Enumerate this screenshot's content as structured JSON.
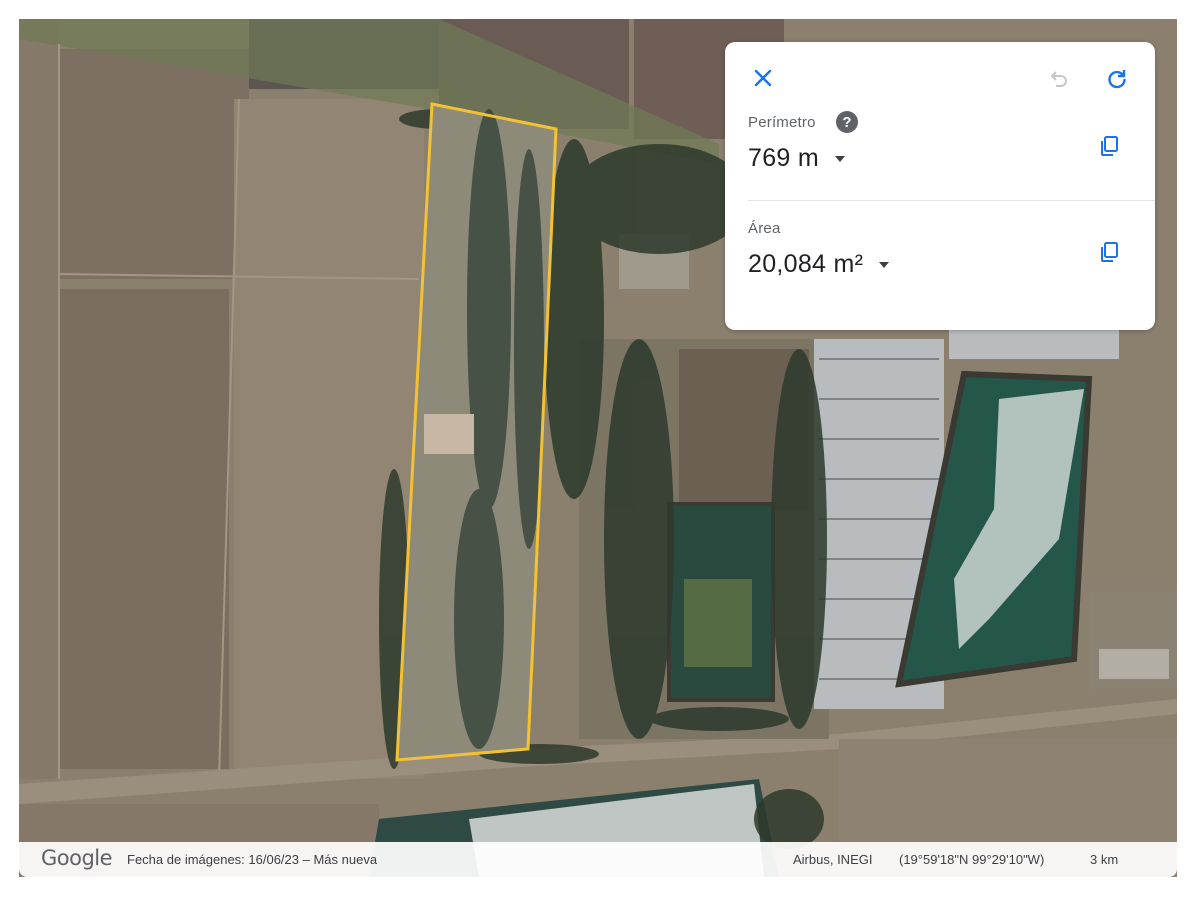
{
  "panel": {
    "close_icon": "close-icon",
    "undo_icon": "undo-icon",
    "redo_icon": "redo-icon",
    "perimeter_label": "Perímetro",
    "perimeter_help_icon": "help-icon",
    "perimeter_help_glyph": "?",
    "perimeter_value": "769 m",
    "area_label": "Área",
    "area_value": "20,084 m²",
    "copy_icon": "copy-icon"
  },
  "footer": {
    "logo": "Google",
    "imagery_date": "Fecha de imágenes: 16/06/23 – Más nueva",
    "attribution": "Airbus, INEGI",
    "coordinates": "(19°59'18\"N 99°29'10\"W)",
    "scale": "3 km"
  },
  "colors": {
    "accent": "#1a73e8",
    "measure_outline": "#f3c234",
    "disabled": "#c4c7c5"
  }
}
